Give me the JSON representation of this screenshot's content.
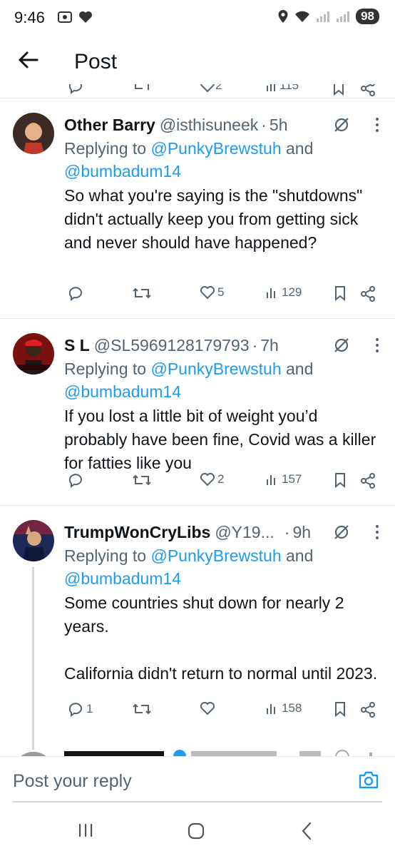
{
  "status_bar": {
    "time": "9:46",
    "battery": "98"
  },
  "header": {
    "title": "Post"
  },
  "prev_tweet": {
    "likes": "2",
    "views": "115"
  },
  "tweets": [
    {
      "name": "Other Barry",
      "handle": "@isthisuneek",
      "time": "5h",
      "replying_prefix": "Replying to ",
      "mention1": "@PunkyBrewstuh",
      "and": " and",
      "mention2": "@bumbadum14",
      "text": "So what you're saying is the \"shutdowns\" didn't actually keep you from getting sick and never should have happened?",
      "replies": "",
      "likes": "5",
      "views": "129"
    },
    {
      "name": "S L",
      "handle": "@SL5969128179793",
      "time": "7h",
      "replying_prefix": "Replying to ",
      "mention1": "@PunkyBrewstuh",
      "and": " and",
      "mention2": "@bumbadum14",
      "text": "If you lost a little bit of weight you’d probably have been fine, Covid was a killer for fatties like you",
      "replies": "",
      "likes": "2",
      "views": "157"
    },
    {
      "name": "TrumpWonCryLibs",
      "handle": "@Y19...",
      "time": "9h",
      "replying_prefix": "Replying to ",
      "mention1": "@PunkyBrewstuh",
      "and": " and",
      "mention2": "@bumbadum14",
      "text": "Some countries shut down for nearly 2 years.\n\nCalifornia didn't return to normal until 2023.",
      "replies": "1",
      "likes": "",
      "views": "158"
    }
  ],
  "reply_bar": {
    "placeholder": "Post your reply"
  },
  "colors": {
    "accent": "#1d9bf0",
    "secondary_text": "#536471",
    "divider": "#e6e9eb"
  }
}
